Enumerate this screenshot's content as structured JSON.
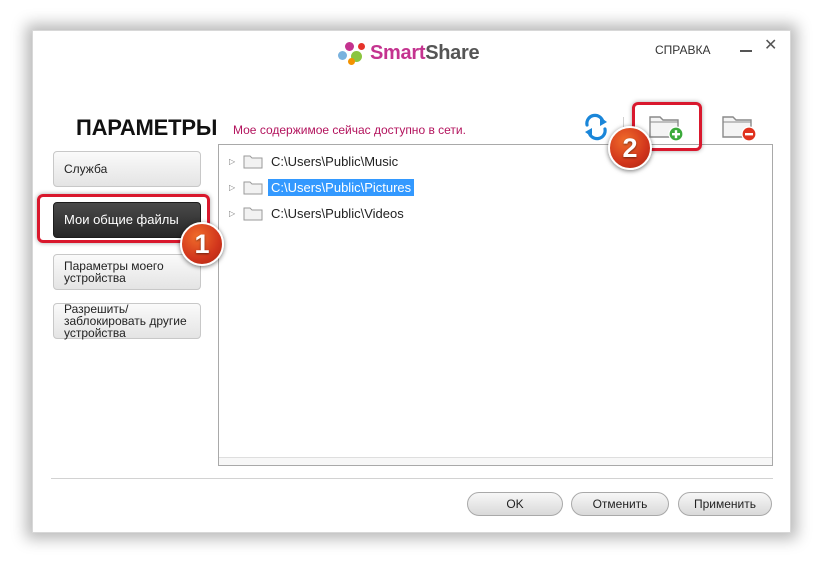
{
  "app": {
    "logo_part1": "Smart",
    "logo_part2": "Share",
    "help_label": "СПРАВКА",
    "close_symbol": "✕"
  },
  "header": {
    "title": "ПАРАМЕТРЫ",
    "status": "Мое содержимое сейчас доступно в сети."
  },
  "toolbar": {
    "icons": [
      "sync-icon",
      "folder-add-icon",
      "folder-remove-icon"
    ]
  },
  "sidebar": {
    "items": [
      {
        "label": "Служба",
        "active": false
      },
      {
        "label": "Мои общие файлы",
        "active": true
      },
      {
        "label": "Параметры моего устройства",
        "active": false
      },
      {
        "label": "Разрешить/ заблокировать другие устройства",
        "active": false
      }
    ]
  },
  "tree": {
    "folders": [
      {
        "path": "C:\\Users\\Public\\Music",
        "selected": false
      },
      {
        "path": "C:\\Users\\Public\\Pictures",
        "selected": true
      },
      {
        "path": "C:\\Users\\Public\\Videos",
        "selected": false
      }
    ]
  },
  "footer": {
    "ok_label": "OK",
    "cancel_label": "Отменить",
    "apply_label": "Применить"
  },
  "callouts": {
    "badge1": "1",
    "badge2": "2"
  },
  "colors": {
    "accent_magenta": "#c4338f",
    "status_text": "#b3135d",
    "selection": "#3399ff",
    "callout_red": "#d9182d"
  }
}
